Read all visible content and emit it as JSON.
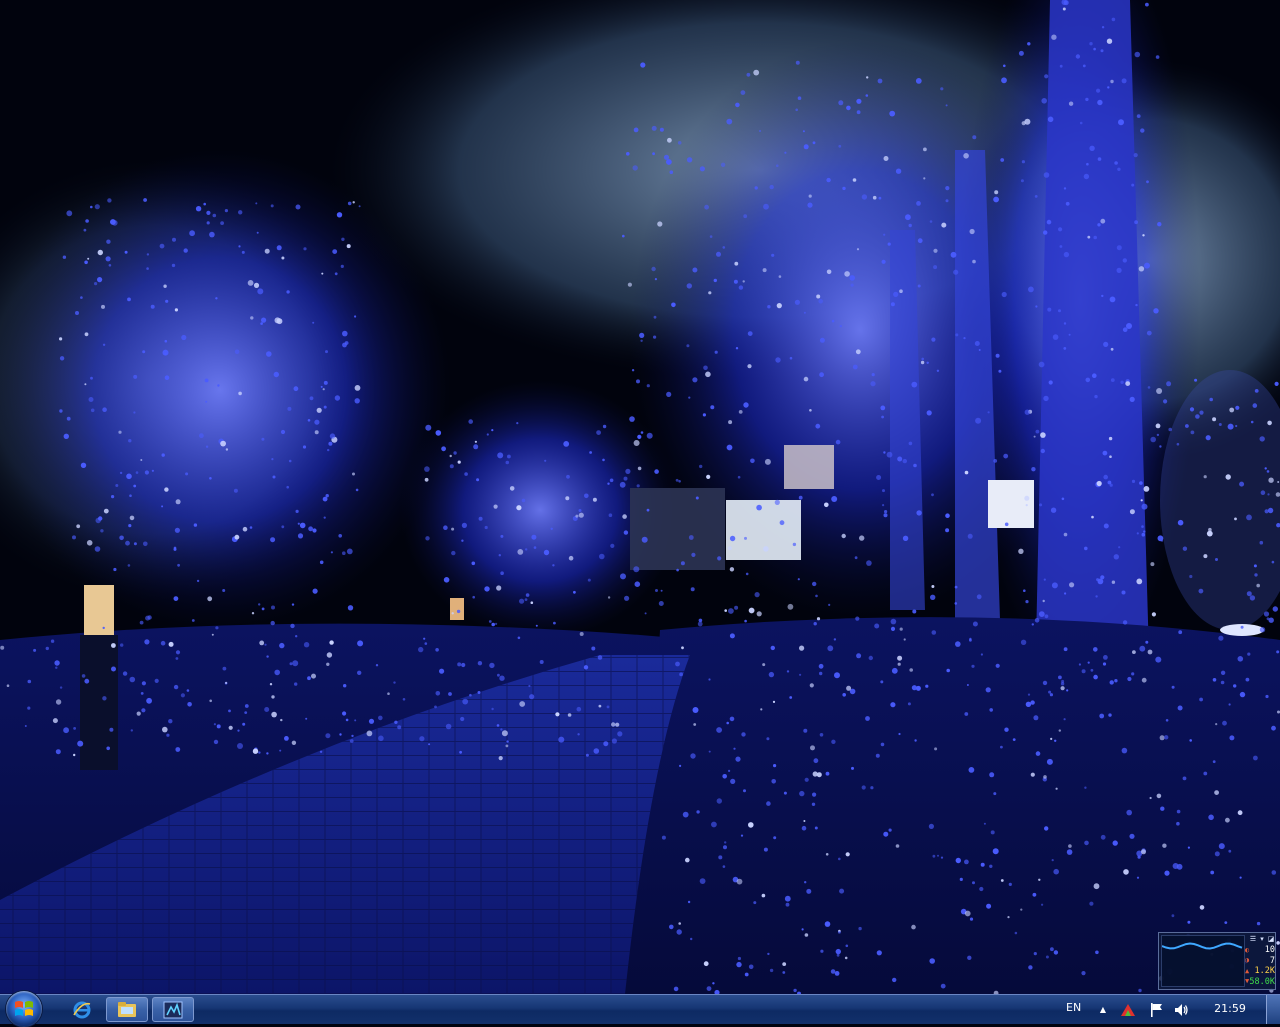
{
  "taskbar": {
    "start_label": "Start",
    "quick_launch": [
      {
        "name": "ie-icon",
        "label": "Internet Explorer"
      },
      {
        "name": "explorer-icon",
        "label": "Windows Explorer"
      },
      {
        "name": "app-icon",
        "label": "Application"
      }
    ],
    "tray": {
      "language": "EN",
      "clock": "21:59"
    }
  },
  "gadget": {
    "stats": [
      "10",
      "7",
      "1.2K",
      "58.0K"
    ],
    "stat_colors": [
      "#ffffff",
      "#ffffff",
      "#ffd24a",
      "#3fdc4a"
    ],
    "graph_color": "#3fa8ff"
  },
  "colors": {
    "taskbar": "#163674",
    "accent_blue": "#1e2fff"
  }
}
